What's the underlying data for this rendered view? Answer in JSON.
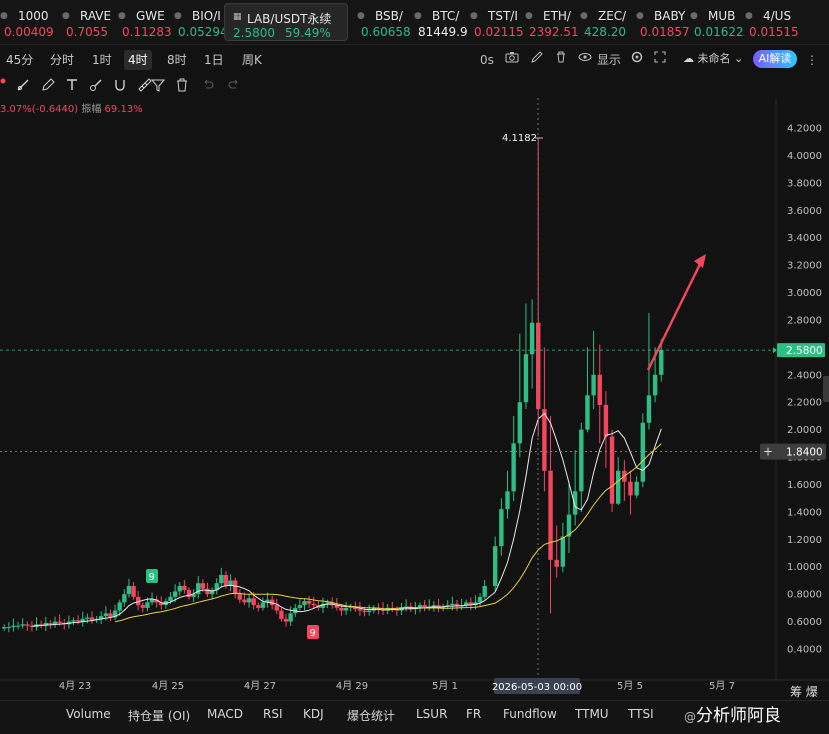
{
  "ticker": [
    {
      "name": "1000",
      "price": "0.00409",
      "color": "red"
    },
    {
      "name": "RAVE",
      "price": "0.7055",
      "color": "red"
    },
    {
      "name": "GWE",
      "price": "0.11283",
      "color": "red"
    },
    {
      "name": "BIO/I",
      "price": "0.05294",
      "color": "green"
    },
    {
      "name": "LAB/USDT永续",
      "price": "2.5800",
      "change": "59.49%",
      "color": "green",
      "active": true
    },
    {
      "name": "BSB/",
      "price": "0.60658",
      "color": "green"
    },
    {
      "name": "BTC/",
      "price": "81449.9",
      "color": "white"
    },
    {
      "name": "TST/I",
      "price": "0.02115",
      "color": "red"
    },
    {
      "name": "ETH/",
      "price": "2392.51",
      "color": "red"
    },
    {
      "name": "ZEC/",
      "price": "428.20",
      "color": "green"
    },
    {
      "name": "BABY",
      "price": "0.01857",
      "color": "red"
    },
    {
      "name": "MUB",
      "price": "0.01622",
      "color": "green"
    },
    {
      "name": "4/US",
      "price": "0.01515",
      "color": "red"
    }
  ],
  "intervals": [
    "45分",
    "分时",
    "1时",
    "4时",
    "8时",
    "1日",
    "周K"
  ],
  "selected_interval": "4时",
  "toolbar": {
    "countdown": "0s",
    "display_label": "显示",
    "layout_name": "未命名",
    "ai_label": "AI解读"
  },
  "stats": {
    "change": "3.07%(-0.6440)",
    "amplitude_label": "振幅",
    "amplitude": "69.13%"
  },
  "chart_data": {
    "type": "candlestick",
    "symbol": "LAB/USDT永续",
    "interval": "4时",
    "ylim": [
      0.25,
      4.3
    ],
    "y_ticks": [
      "4.2000",
      "4.0000",
      "3.8000",
      "3.6000",
      "3.4000",
      "3.2000",
      "3.0000",
      "2.8000",
      "2.6000",
      "2.4000",
      "2.2000",
      "2.0000",
      "1.8000",
      "1.6000",
      "1.4000",
      "1.2000",
      "1.0000",
      "0.8000",
      "0.6000",
      "0.4000"
    ],
    "x_ticks": [
      "4月 23",
      "4月 25",
      "4月 27",
      "4月 29",
      "5月 1",
      "5月 3",
      "5月 5",
      "5月 7"
    ],
    "crosshair_x_label": "2026-05-03 00:00",
    "crosshair_y_label": "1.8400",
    "last_price_label": "2.5800",
    "high_label": "4.1182",
    "markers": [
      "9",
      "9"
    ],
    "colors": {
      "up": "#2ebd85",
      "down": "#f6465d",
      "ma_fast": "#e8e8e8",
      "ma_slow": "#e5d13f",
      "last": "#2ebd85",
      "arrow": "#f6465d"
    }
  },
  "bottom_tabs": [
    "Volume",
    "持仓量 (OI)",
    "MACD",
    "RSI",
    "KDJ",
    "爆仓统计",
    "LSUR",
    "FR",
    "Fundflow",
    "TTMU",
    "TTSI"
  ],
  "right_corner": "筹 爆",
  "watermark": {
    "at": "@",
    "text": "分析师阿良"
  }
}
